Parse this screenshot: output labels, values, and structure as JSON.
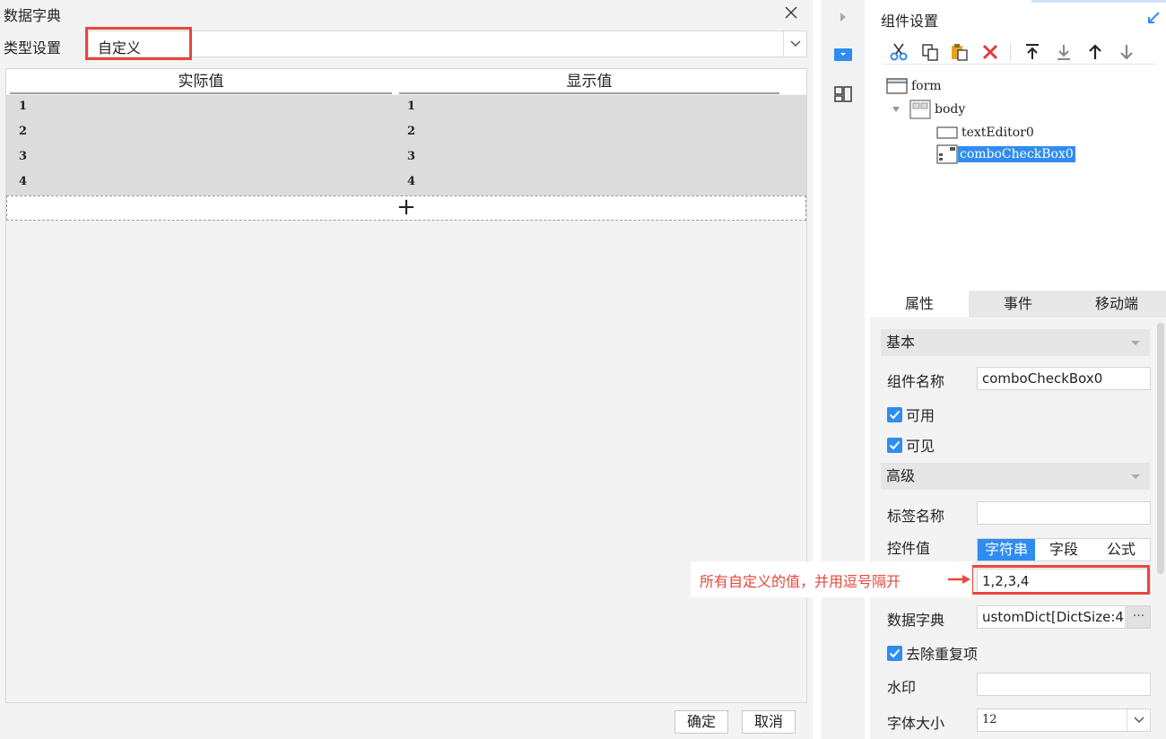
{
  "dialog": {
    "title": "数据字典",
    "type_label": "类型设置",
    "type_value": "自定义",
    "columns": [
      "实际值",
      "显示值"
    ],
    "rows": [
      {
        "actual": "1",
        "display": "1"
      },
      {
        "actual": "2",
        "display": "2"
      },
      {
        "actual": "3",
        "display": "3"
      },
      {
        "actual": "4",
        "display": "4"
      }
    ],
    "add_symbol": "+",
    "ok_label": "确定",
    "cancel_label": "取消"
  },
  "panel": {
    "title": "组件设置",
    "tree": {
      "form": "form",
      "body": "body",
      "text_editor": "textEditor0",
      "combo": "comboCheckBox0"
    },
    "tabs": [
      "属性",
      "事件",
      "移动端"
    ],
    "basic_label": "基本",
    "name_label": "组件名称",
    "name_value": "comboCheckBox0",
    "enabled_label": "可用",
    "visible_label": "可见",
    "advanced_label": "高级",
    "tag_label": "标签名称",
    "tag_value": "",
    "control_value_label": "控件值",
    "control_value_modes": [
      "字符串",
      "字段",
      "公式"
    ],
    "control_value": "1,2,3,4",
    "dict_label": "数据字典",
    "dict_value": "ustomDict[DictSize:4]",
    "dict_more": "···",
    "dedupe_label": "去除重复项",
    "watermark_label": "水印",
    "watermark_value": "",
    "font_size_label": "字体大小",
    "font_size_value": "12"
  },
  "annotation": "所有自定义的值，并用逗号隔开",
  "colors": {
    "accent_blue": "#2f8cf0",
    "highlight_red": "#e8473e"
  }
}
